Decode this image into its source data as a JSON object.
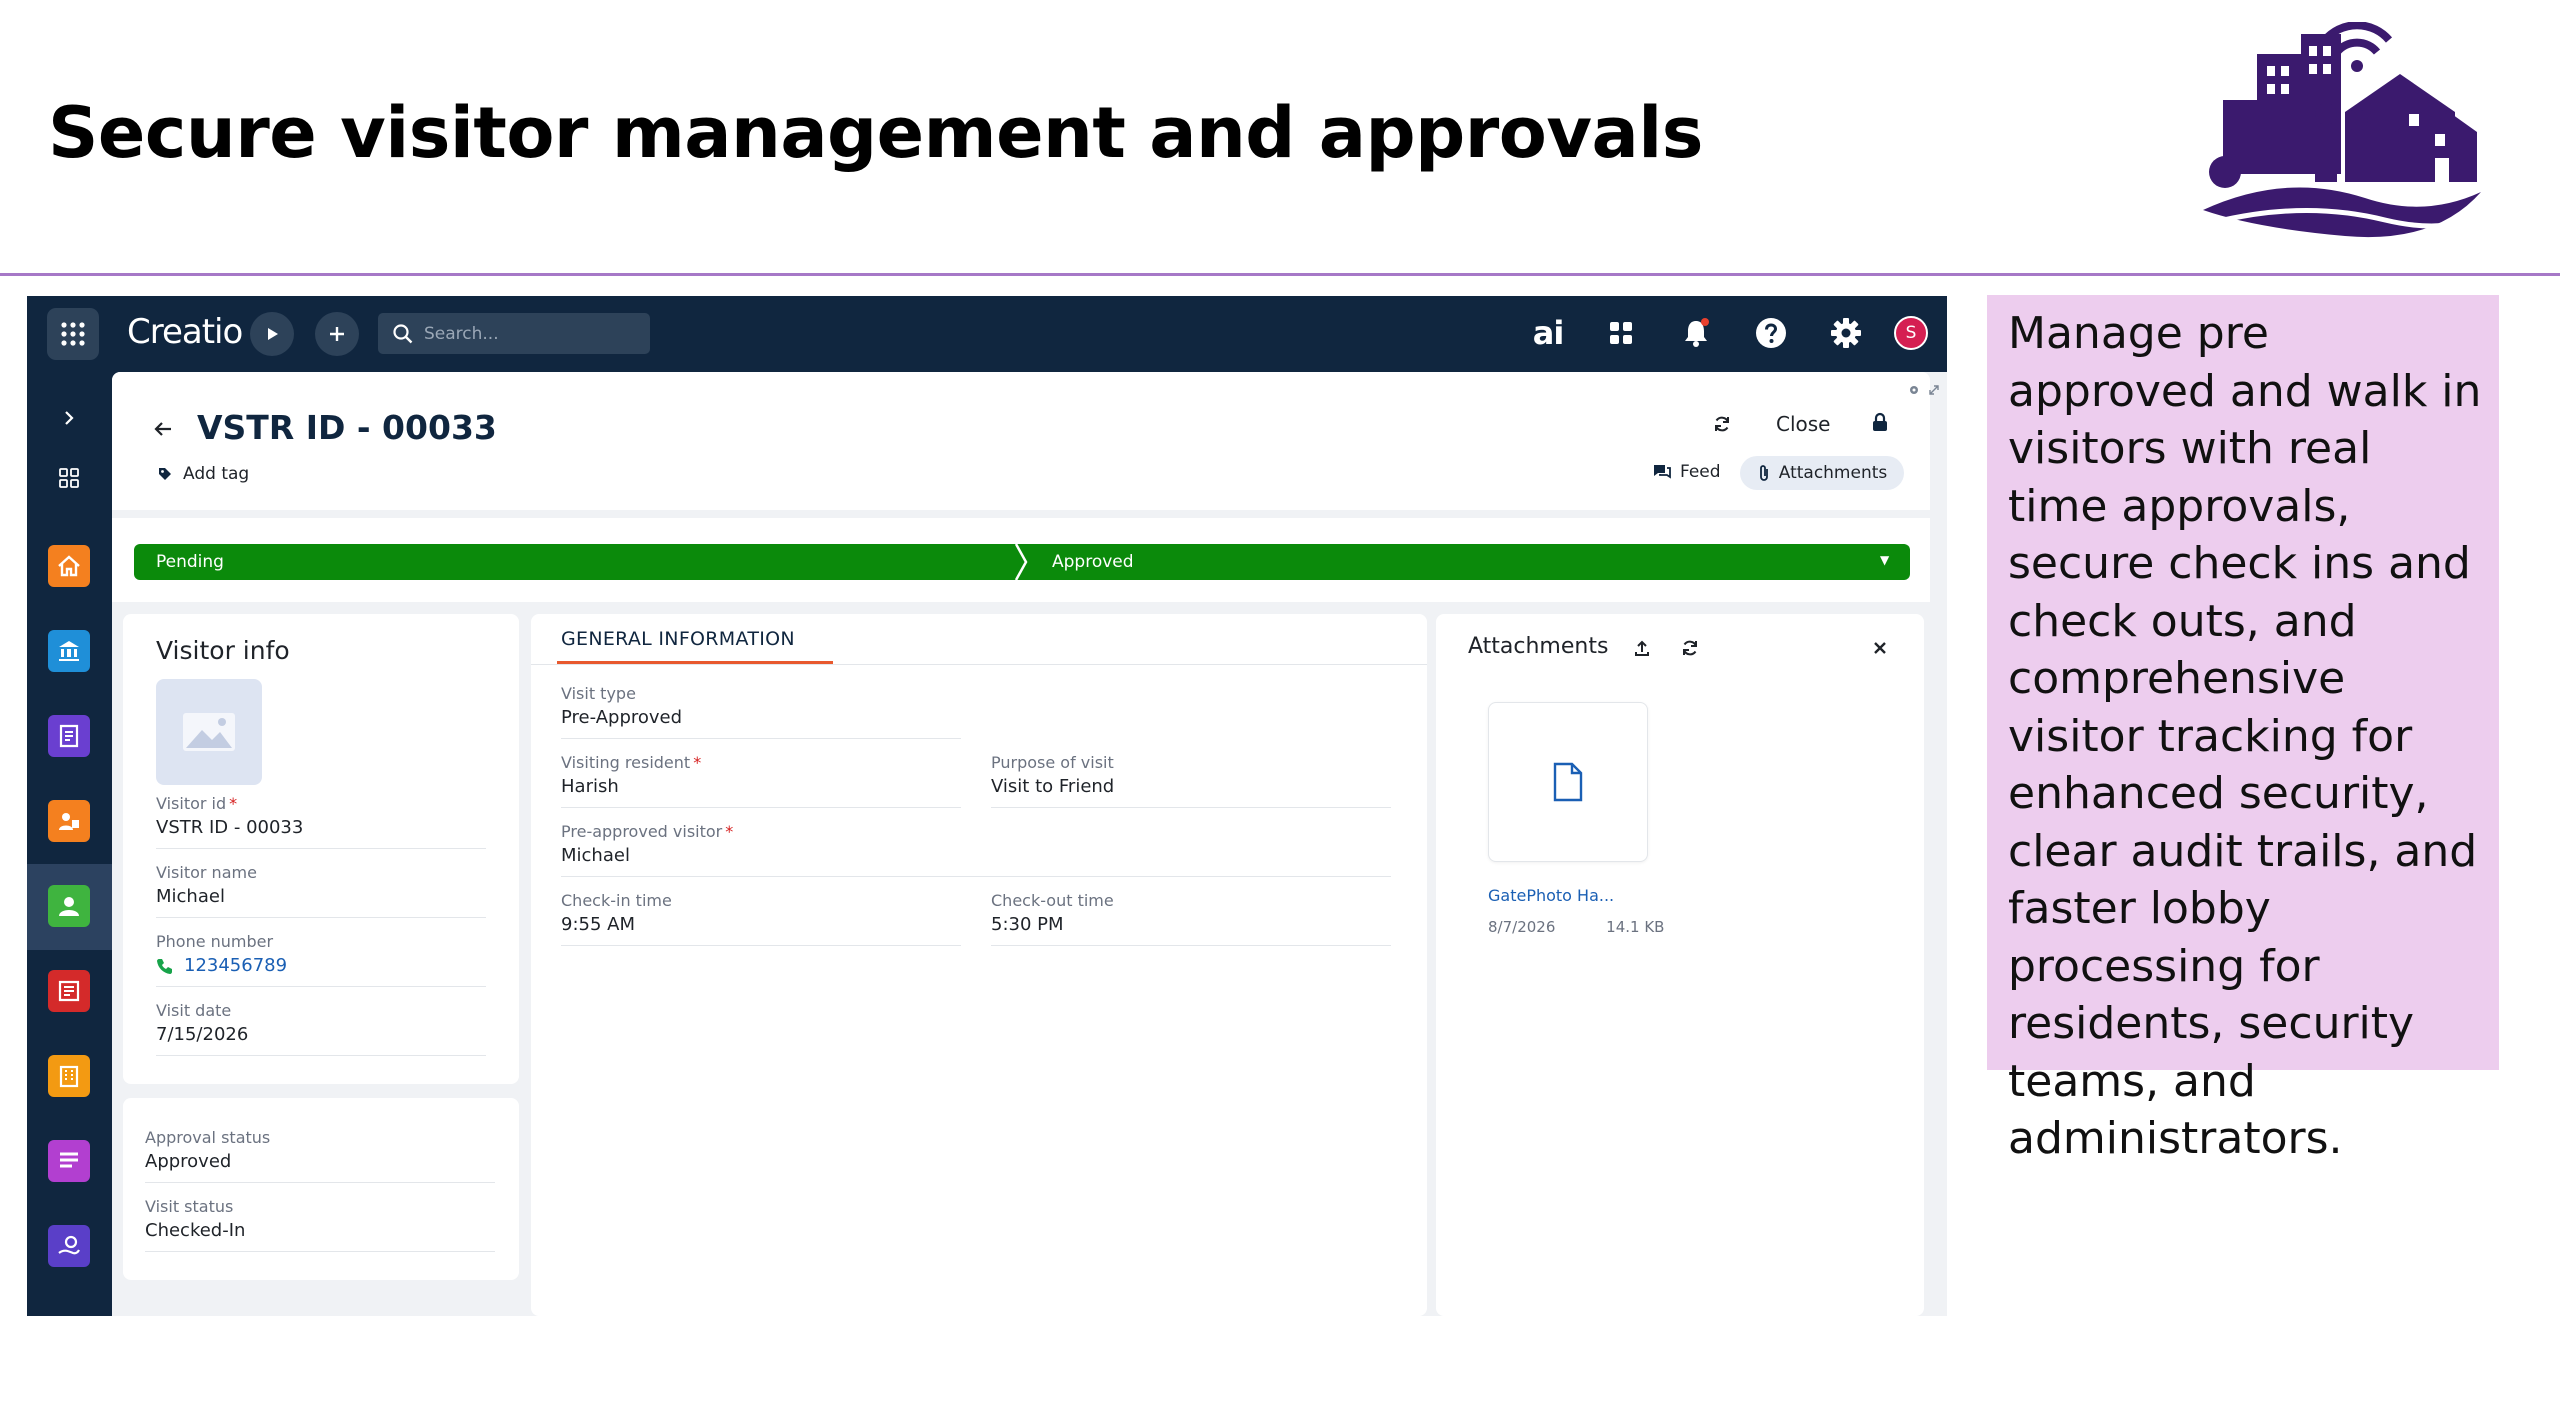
{
  "slide": {
    "title": "Secure visitor management and approvals",
    "description": "Manage pre approved and walk in visitors with real time approvals, secure check ins and check outs, and comprehensive visitor tracking for enhanced security, clear audit trails, and faster lobby processing for residents, security teams, and administrators."
  },
  "app": {
    "brand": "Creatio",
    "search_placeholder": "Search...",
    "ai_label": "ai",
    "avatar_initial": "S",
    "colors": {
      "nav_bg": "#10263f",
      "stage_green": "#0b8a0b",
      "accent_orange": "#e8592e",
      "link_blue": "#1a5fb4"
    }
  },
  "record": {
    "title": "VSTR ID - 00033",
    "add_tag": "Add tag",
    "close_label": "Close",
    "feed_label": "Feed",
    "attachments_label": "Attachments"
  },
  "stages": [
    "Pending",
    "Approved"
  ],
  "visitor_info": {
    "heading": "Visitor info",
    "fields": [
      {
        "label": "Visitor id",
        "value": "VSTR ID - 00033",
        "required": true
      },
      {
        "label": "Visitor name",
        "value": "Michael"
      },
      {
        "label": "Phone number",
        "value": "123456789"
      },
      {
        "label": "Visit date",
        "value": "7/15/2026"
      }
    ]
  },
  "status_card": {
    "fields": [
      {
        "label": "Approval status",
        "value": "Approved"
      },
      {
        "label": "Visit status",
        "value": "Checked-In"
      }
    ]
  },
  "general": {
    "tab": "GENERAL INFORMATION",
    "visit_type": {
      "label": "Visit type",
      "value": "Pre-Approved"
    },
    "visiting_resident": {
      "label": "Visiting resident",
      "value": "Harish"
    },
    "purpose": {
      "label": "Purpose of visit",
      "value": "Visit to Friend"
    },
    "pre_approved_visitor": {
      "label": "Pre-approved visitor",
      "value": "Michael"
    },
    "check_in": {
      "label": "Check-in time",
      "value": "9:55 AM"
    },
    "check_out": {
      "label": "Check-out time",
      "value": "5:30 PM"
    }
  },
  "attachments_panel": {
    "heading": "Attachments",
    "file": {
      "name": "GatePhoto Ha...",
      "date": "8/7/2026",
      "size": "14.1 KB"
    }
  }
}
